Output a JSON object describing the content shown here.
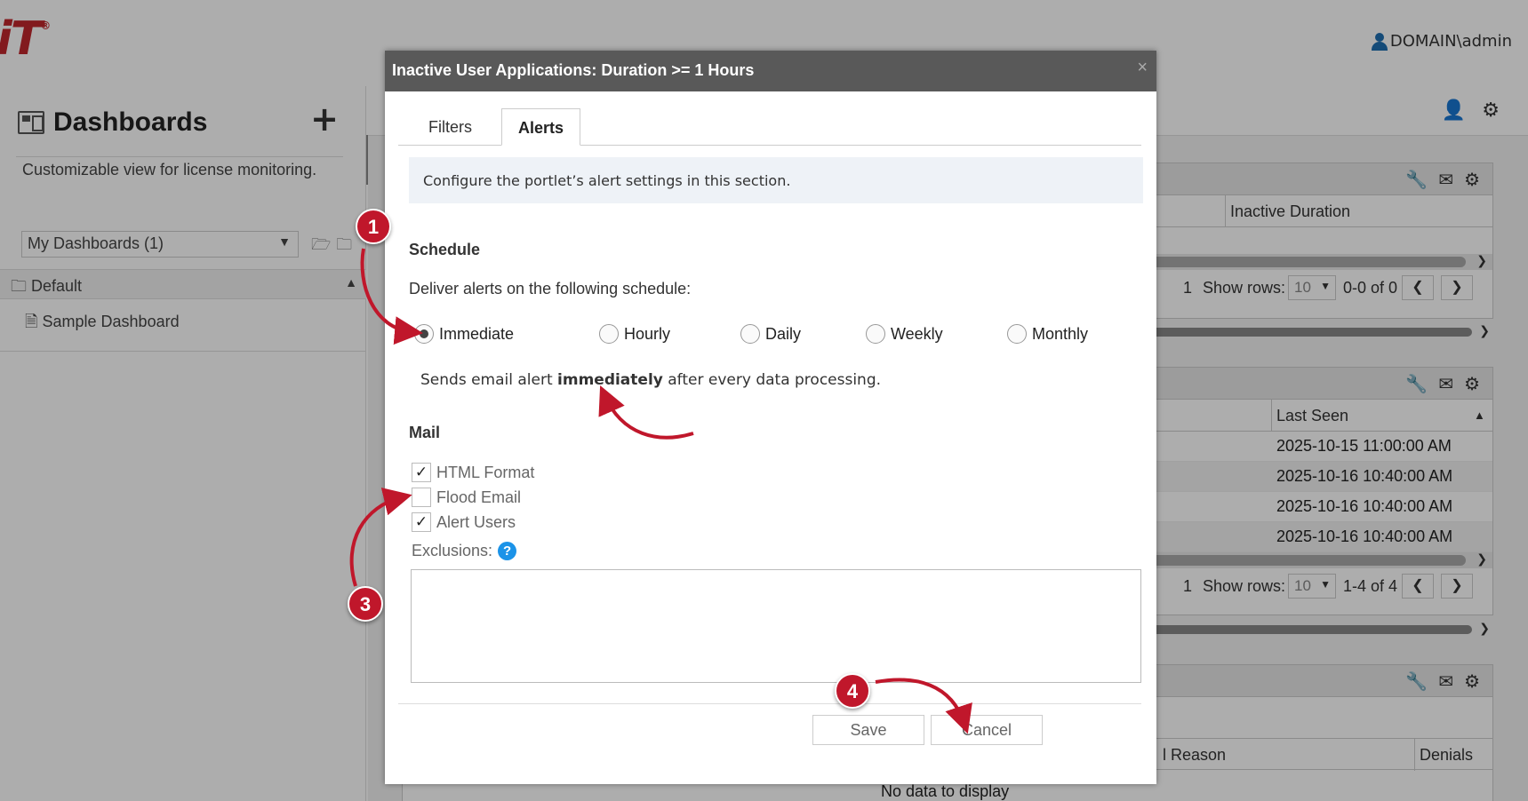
{
  "app": {
    "logo_text": "iT",
    "logo_mark": "®",
    "user": "DOMAIN\\admin"
  },
  "sidebar": {
    "title": "Dashboards",
    "add_label": "+",
    "description": "Customizable view for license monitoring.",
    "select_value": "My Dashboards (1)",
    "group_label": "Default",
    "item_label": "Sample Dashboard"
  },
  "portlets": [
    {
      "col_inactive": "Inactive Duration",
      "page": "1",
      "show_rows_label": "Show rows:",
      "rows_value": "10",
      "range": "0-0 of 0"
    },
    {
      "col_last_seen": "Last Seen",
      "rows": [
        "2025-10-15 11:00:00 AM",
        "2025-10-16 10:40:00 AM",
        "2025-10-16 10:40:00 AM",
        "2025-10-16 10:40:00 AM"
      ],
      "page": "1",
      "show_rows_label": "Show rows:",
      "rows_value": "10",
      "range": "1-4 of 4"
    },
    {
      "col_reason": "l Reason",
      "col_denials": "Denials",
      "no_data": "No data to display"
    }
  ],
  "modal": {
    "title": "Inactive User Applications: Duration >= 1 Hours",
    "close": "×",
    "tabs": [
      {
        "label": "Filters"
      },
      {
        "label": "Alerts"
      }
    ],
    "info": "Configure the portlet’s alert settings in this section.",
    "schedule_heading": "Schedule",
    "schedule_prompt": "Deliver alerts on the following schedule:",
    "schedule_options": [
      "Immediate",
      "Hourly",
      "Daily",
      "Weekly",
      "Monthly"
    ],
    "schedule_selected": "Immediate",
    "note_prefix": "Sends email alert ",
    "note_bold": "immediately",
    "note_suffix": " after every data processing.",
    "mail_heading": "Mail",
    "checkboxes": [
      {
        "label": "HTML Format",
        "checked": true,
        "mark": "✓"
      },
      {
        "label": "Flood Email",
        "checked": false,
        "mark": ""
      },
      {
        "label": "Alert Users",
        "checked": true,
        "mark": "✓"
      }
    ],
    "exclusions_label": "Exclusions:",
    "help_glyph": "?",
    "save_label": "Save",
    "cancel_label": "Cancel"
  },
  "annotations": {
    "badges": [
      "1",
      "3",
      "4"
    ],
    "color": "#c0172b"
  }
}
